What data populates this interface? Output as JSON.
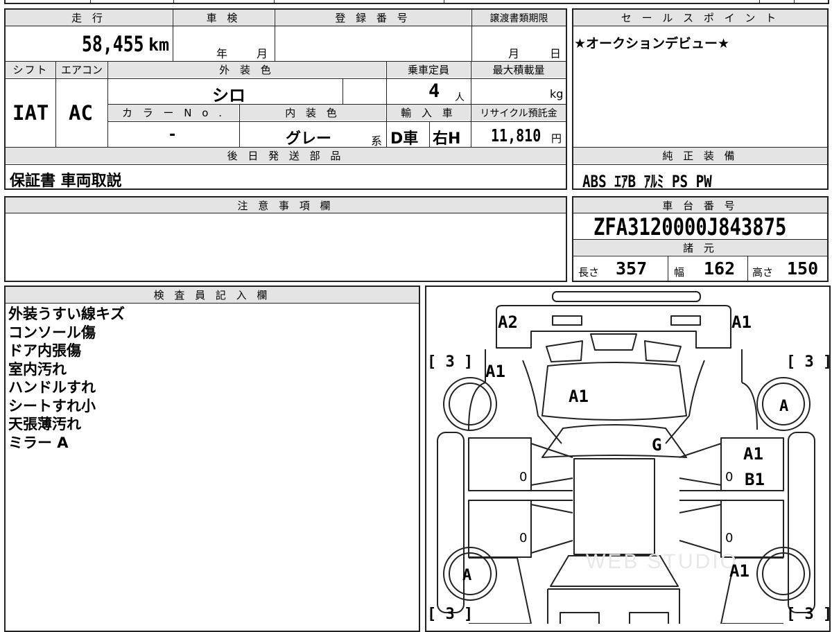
{
  "table_headers": {
    "mileage": "走 行",
    "inspection": "車 検",
    "registration": "登 録 番 号",
    "transfer_deadline": "譲渡書類期限",
    "sales_point": "セ ー ル ス ポ イ ン ト",
    "shift": "シフト",
    "aircon": "エアコン",
    "exterior_color": "外 装 色",
    "capacity": "乗車定員",
    "max_load": "最大積載量",
    "color_no": "カ ラ ー N o .",
    "interior_color": "内 装 色",
    "import_car": "輸 入 車",
    "recycle_fee": "リサイクル預託金",
    "later_parts": "後 日 発 送 部 品",
    "genuine_equipment": "純 正 装 備",
    "caution": "注 意 事 項 欄",
    "chassis_no": "車 台 番 号",
    "specs": "諸 元",
    "inspector_notes": "検 査 員 記 入 欄"
  },
  "values": {
    "mileage": "58,455",
    "mileage_unit": "km",
    "inspection_year": "年",
    "inspection_month": "月",
    "deadline_month": "月",
    "deadline_day": "日",
    "sales_point": "★オークションデビュー★",
    "shift": "IAT",
    "aircon": "AC",
    "exterior_color": "シロ",
    "capacity": "4",
    "capacity_unit": "人",
    "max_load_unit": "kg",
    "color_no": "-",
    "interior_color": "グレー",
    "interior_suffix": "系",
    "import_drive": "D車",
    "import_handle": "右H",
    "recycle_fee": "11,810",
    "recycle_unit": "円",
    "later_parts": "保証書 車両取説",
    "equipment": [
      "ABS",
      "ｴｱB",
      "ｱﾙﾐ",
      "PS",
      "PW"
    ],
    "chassis_no": "ZFA3120000J843875",
    "length_label": "長さ",
    "length": "357",
    "width_label": "幅",
    "width": "162",
    "height_label": "高さ",
    "height": "150"
  },
  "inspector_notes": [
    "外装うすい線キズ",
    "コンソール傷",
    "ドア内張傷",
    "室内汚れ",
    "ハンドルすれ",
    "シートすれ小",
    "天張薄汚れ",
    "ミラー A"
  ],
  "diagram": {
    "marks": {
      "front_left_corner": "A2",
      "front_right_corner": "A1",
      "hood": "A1",
      "left_front_fender": "A1",
      "right_front_wheel": "A",
      "windshield": "G",
      "right_front_door_1": "A1",
      "right_front_door_2": "B1",
      "left_rear_wheel": "A",
      "right_rear_quarter": "A1"
    },
    "tires": [
      "[ 3 ]",
      "[ 3 ]",
      "[ 3 ]",
      "[ 3 ]"
    ],
    "zeros": [
      "0",
      "0",
      "0",
      "0"
    ],
    "watermark": "WEB STUDIO"
  }
}
